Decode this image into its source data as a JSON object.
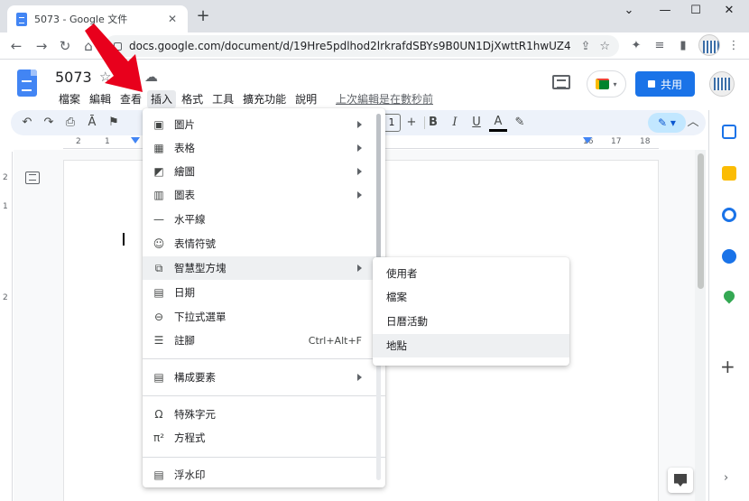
{
  "browser": {
    "tab_title": "5073 - Google 文件",
    "tab_close": "✕",
    "new_tab": "+",
    "window_controls": {
      "collapse": "⌄",
      "minimize": "—",
      "maximize": "☐",
      "close": "✕"
    },
    "nav": {
      "back": "←",
      "forward": "→",
      "reload": "↻",
      "home": "⌂"
    },
    "url": "docs.google.com/document/d/19Hre5pdlhod2lrkrafdSBYs9B0UN1DjXwttR1hwUZ44/e...",
    "url_icons": {
      "share": "⇪",
      "star": "☆"
    },
    "extension_icons": {
      "puzzle": "✦",
      "media": "≡",
      "sidepanel": "▮"
    }
  },
  "docs": {
    "title": "5073",
    "title_icons": {
      "star": "☆",
      "move": "▭",
      "cloud": "☁"
    },
    "menus": [
      "檔案",
      "編輯",
      "查看",
      "插入",
      "格式",
      "工具",
      "擴充功能",
      "說明"
    ],
    "active_menu_index": 3,
    "last_edit": "上次編輯是在數秒前",
    "share_label": "共用",
    "meet_caret": "▾"
  },
  "edit_toolbar": {
    "undo": "↶",
    "redo": "↷",
    "print": "⎙",
    "spellcheck": "Ā",
    "paint_format": "⚑",
    "font_size": "1",
    "increase_size": "+",
    "bold": "B",
    "italic": "I",
    "underline": "U",
    "text_color": "A",
    "highlight": "✎",
    "editing_mode": "✎ ▾",
    "collapse": "︿"
  },
  "ruler": {
    "left_labels": [
      "2",
      "1"
    ],
    "right_labels": [
      "16",
      "17",
      "18"
    ],
    "vertical_labels": [
      "2",
      "1",
      "2"
    ]
  },
  "insert_menu": {
    "items": [
      {
        "label": "圖片",
        "icon": "image-icon",
        "glyph": "▣",
        "submenu": true
      },
      {
        "label": "表格",
        "icon": "table-icon",
        "glyph": "▦",
        "submenu": true
      },
      {
        "label": "繪圖",
        "icon": "drawing-icon",
        "glyph": "◩",
        "submenu": true
      },
      {
        "label": "圖表",
        "icon": "chart-icon",
        "glyph": "▥",
        "submenu": true
      },
      {
        "label": "水平線",
        "icon": "horizontal-line-icon",
        "glyph": "—",
        "submenu": false
      },
      {
        "label": "表情符號",
        "icon": "emoji-icon",
        "glyph": "☺",
        "submenu": false
      },
      {
        "label": "智慧型方塊",
        "icon": "smart-chip-icon",
        "glyph": "⧉",
        "submenu": true
      },
      {
        "label": "日期",
        "icon": "calendar-icon",
        "glyph": "▤",
        "submenu": false
      },
      {
        "label": "下拉式選單",
        "icon": "dropdown-icon",
        "glyph": "⊖",
        "submenu": false
      },
      {
        "label": "註腳",
        "icon": "footnote-icon",
        "glyph": "☰",
        "submenu": false,
        "shortcut": "Ctrl+Alt+F"
      },
      {
        "label": "構成要素",
        "icon": "building-blocks-icon",
        "glyph": "▤",
        "submenu": true
      },
      {
        "label": "特殊字元",
        "icon": "omega-icon",
        "glyph": "Ω",
        "submenu": false
      },
      {
        "label": "方程式",
        "icon": "pi-icon",
        "glyph": "π²",
        "submenu": false
      },
      {
        "label": "浮水印",
        "icon": "watermark-icon",
        "glyph": "▤",
        "submenu": false
      }
    ]
  },
  "smart_chip_submenu": {
    "items": [
      "使用者",
      "檔案",
      "日曆活動",
      "地點"
    ],
    "hovered_index": 3
  },
  "colors": {
    "accent": "#1a73e8",
    "arrow": "#e8001c",
    "menu_hover": "#eef0f2"
  }
}
